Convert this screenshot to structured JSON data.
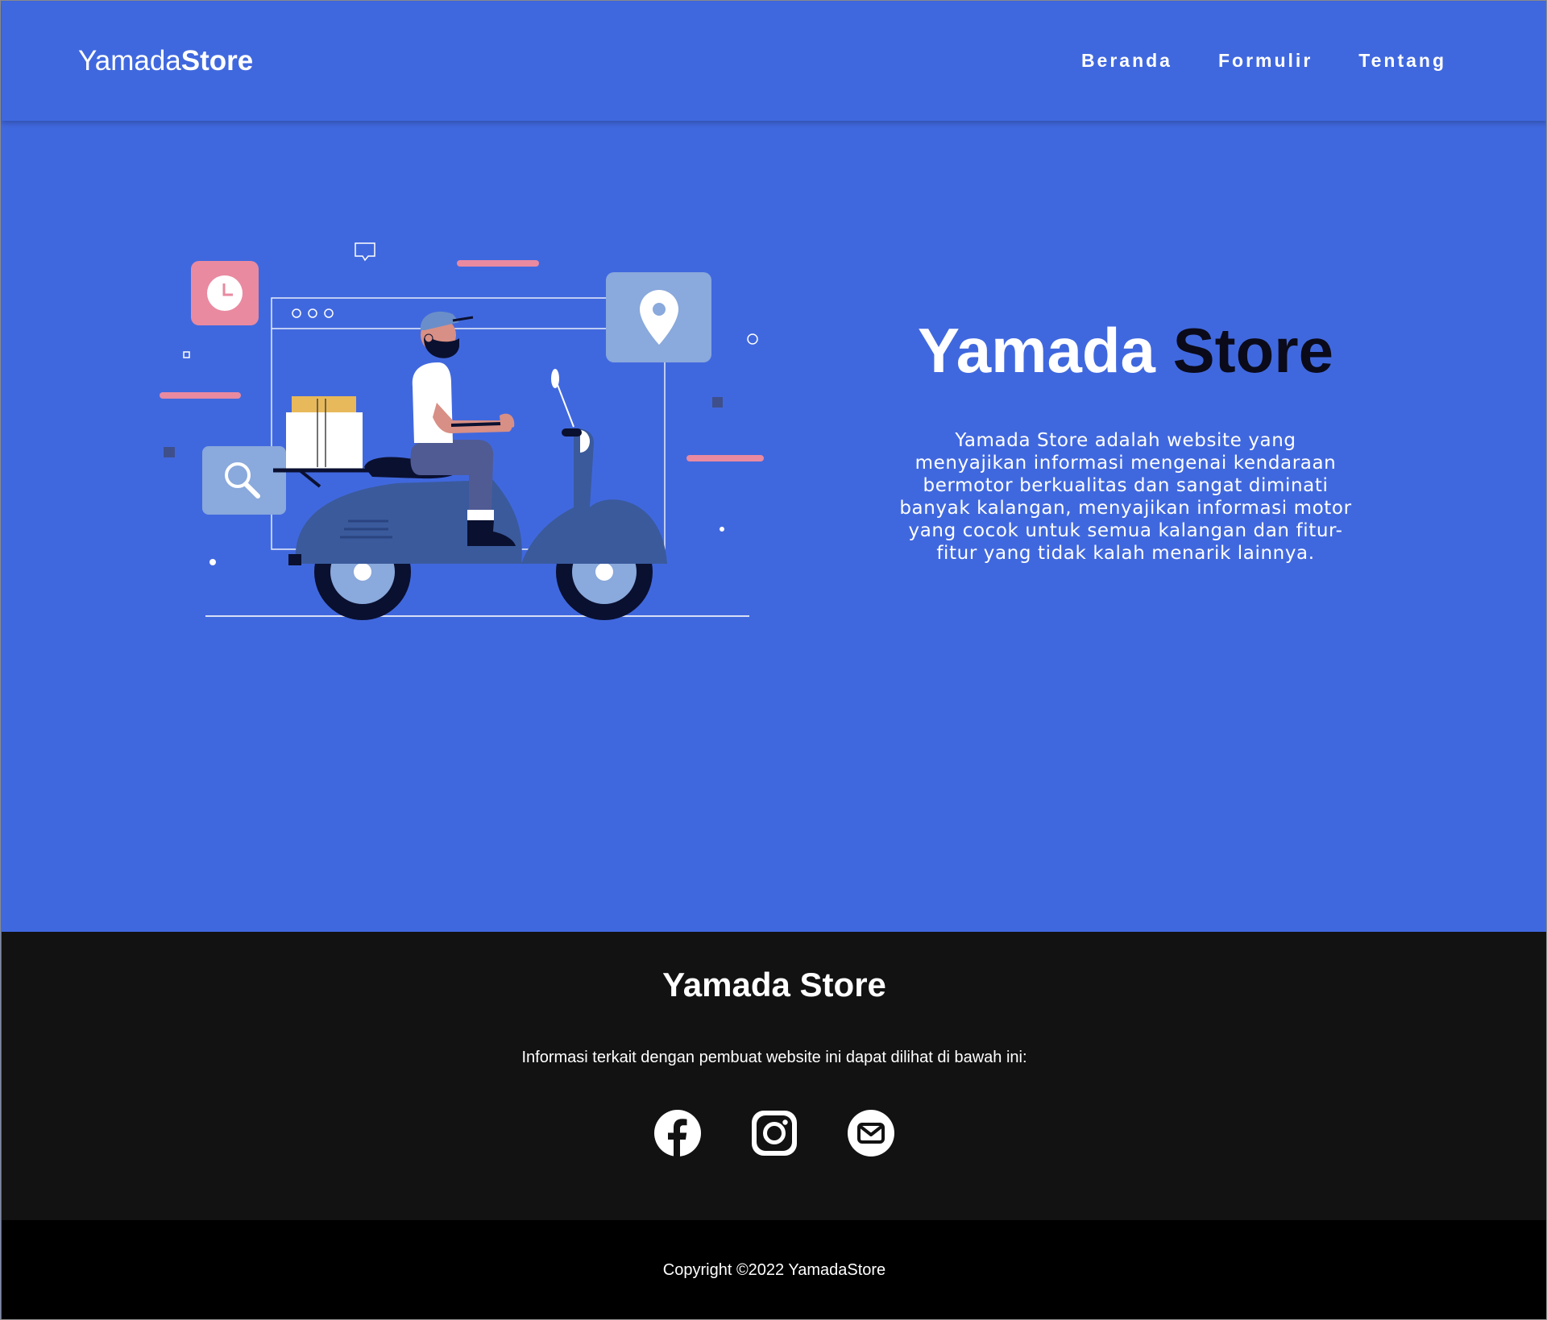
{
  "header": {
    "logo_light": "Yamada",
    "logo_bold": "Store",
    "nav": [
      {
        "label": "Beranda"
      },
      {
        "label": "Formulir"
      },
      {
        "label": "Tentang"
      }
    ]
  },
  "hero": {
    "title_light": "Yamada",
    "title_dark": "Store",
    "description": "Yamada Store adalah website yang menyajikan informasi mengenai kendaraan bermotor berkualitas dan sangat diminati banyak kalangan, menyajikan informasi motor yang cocok untuk semua kalangan dan fitur-fitur yang tidak kalah menarik lainnya.",
    "illustration_icon": "delivery-scooter-illustration"
  },
  "footer": {
    "title": "Yamada Store",
    "info": "Informasi terkait dengan pembuat website ini dapat dilihat di bawah ini:",
    "socials": [
      {
        "icon": "facebook-icon"
      },
      {
        "icon": "instagram-icon"
      },
      {
        "icon": "email-icon"
      }
    ]
  },
  "copyright": "Copyright ©2022  YamadaStore",
  "colors": {
    "primary": "#4068de",
    "footer_bg": "#121212",
    "copyright_bg": "#000000",
    "accent_pink": "#e98aa0",
    "accent_light_blue": "#8aa9dc",
    "scooter_blue": "#3a5a9c"
  }
}
